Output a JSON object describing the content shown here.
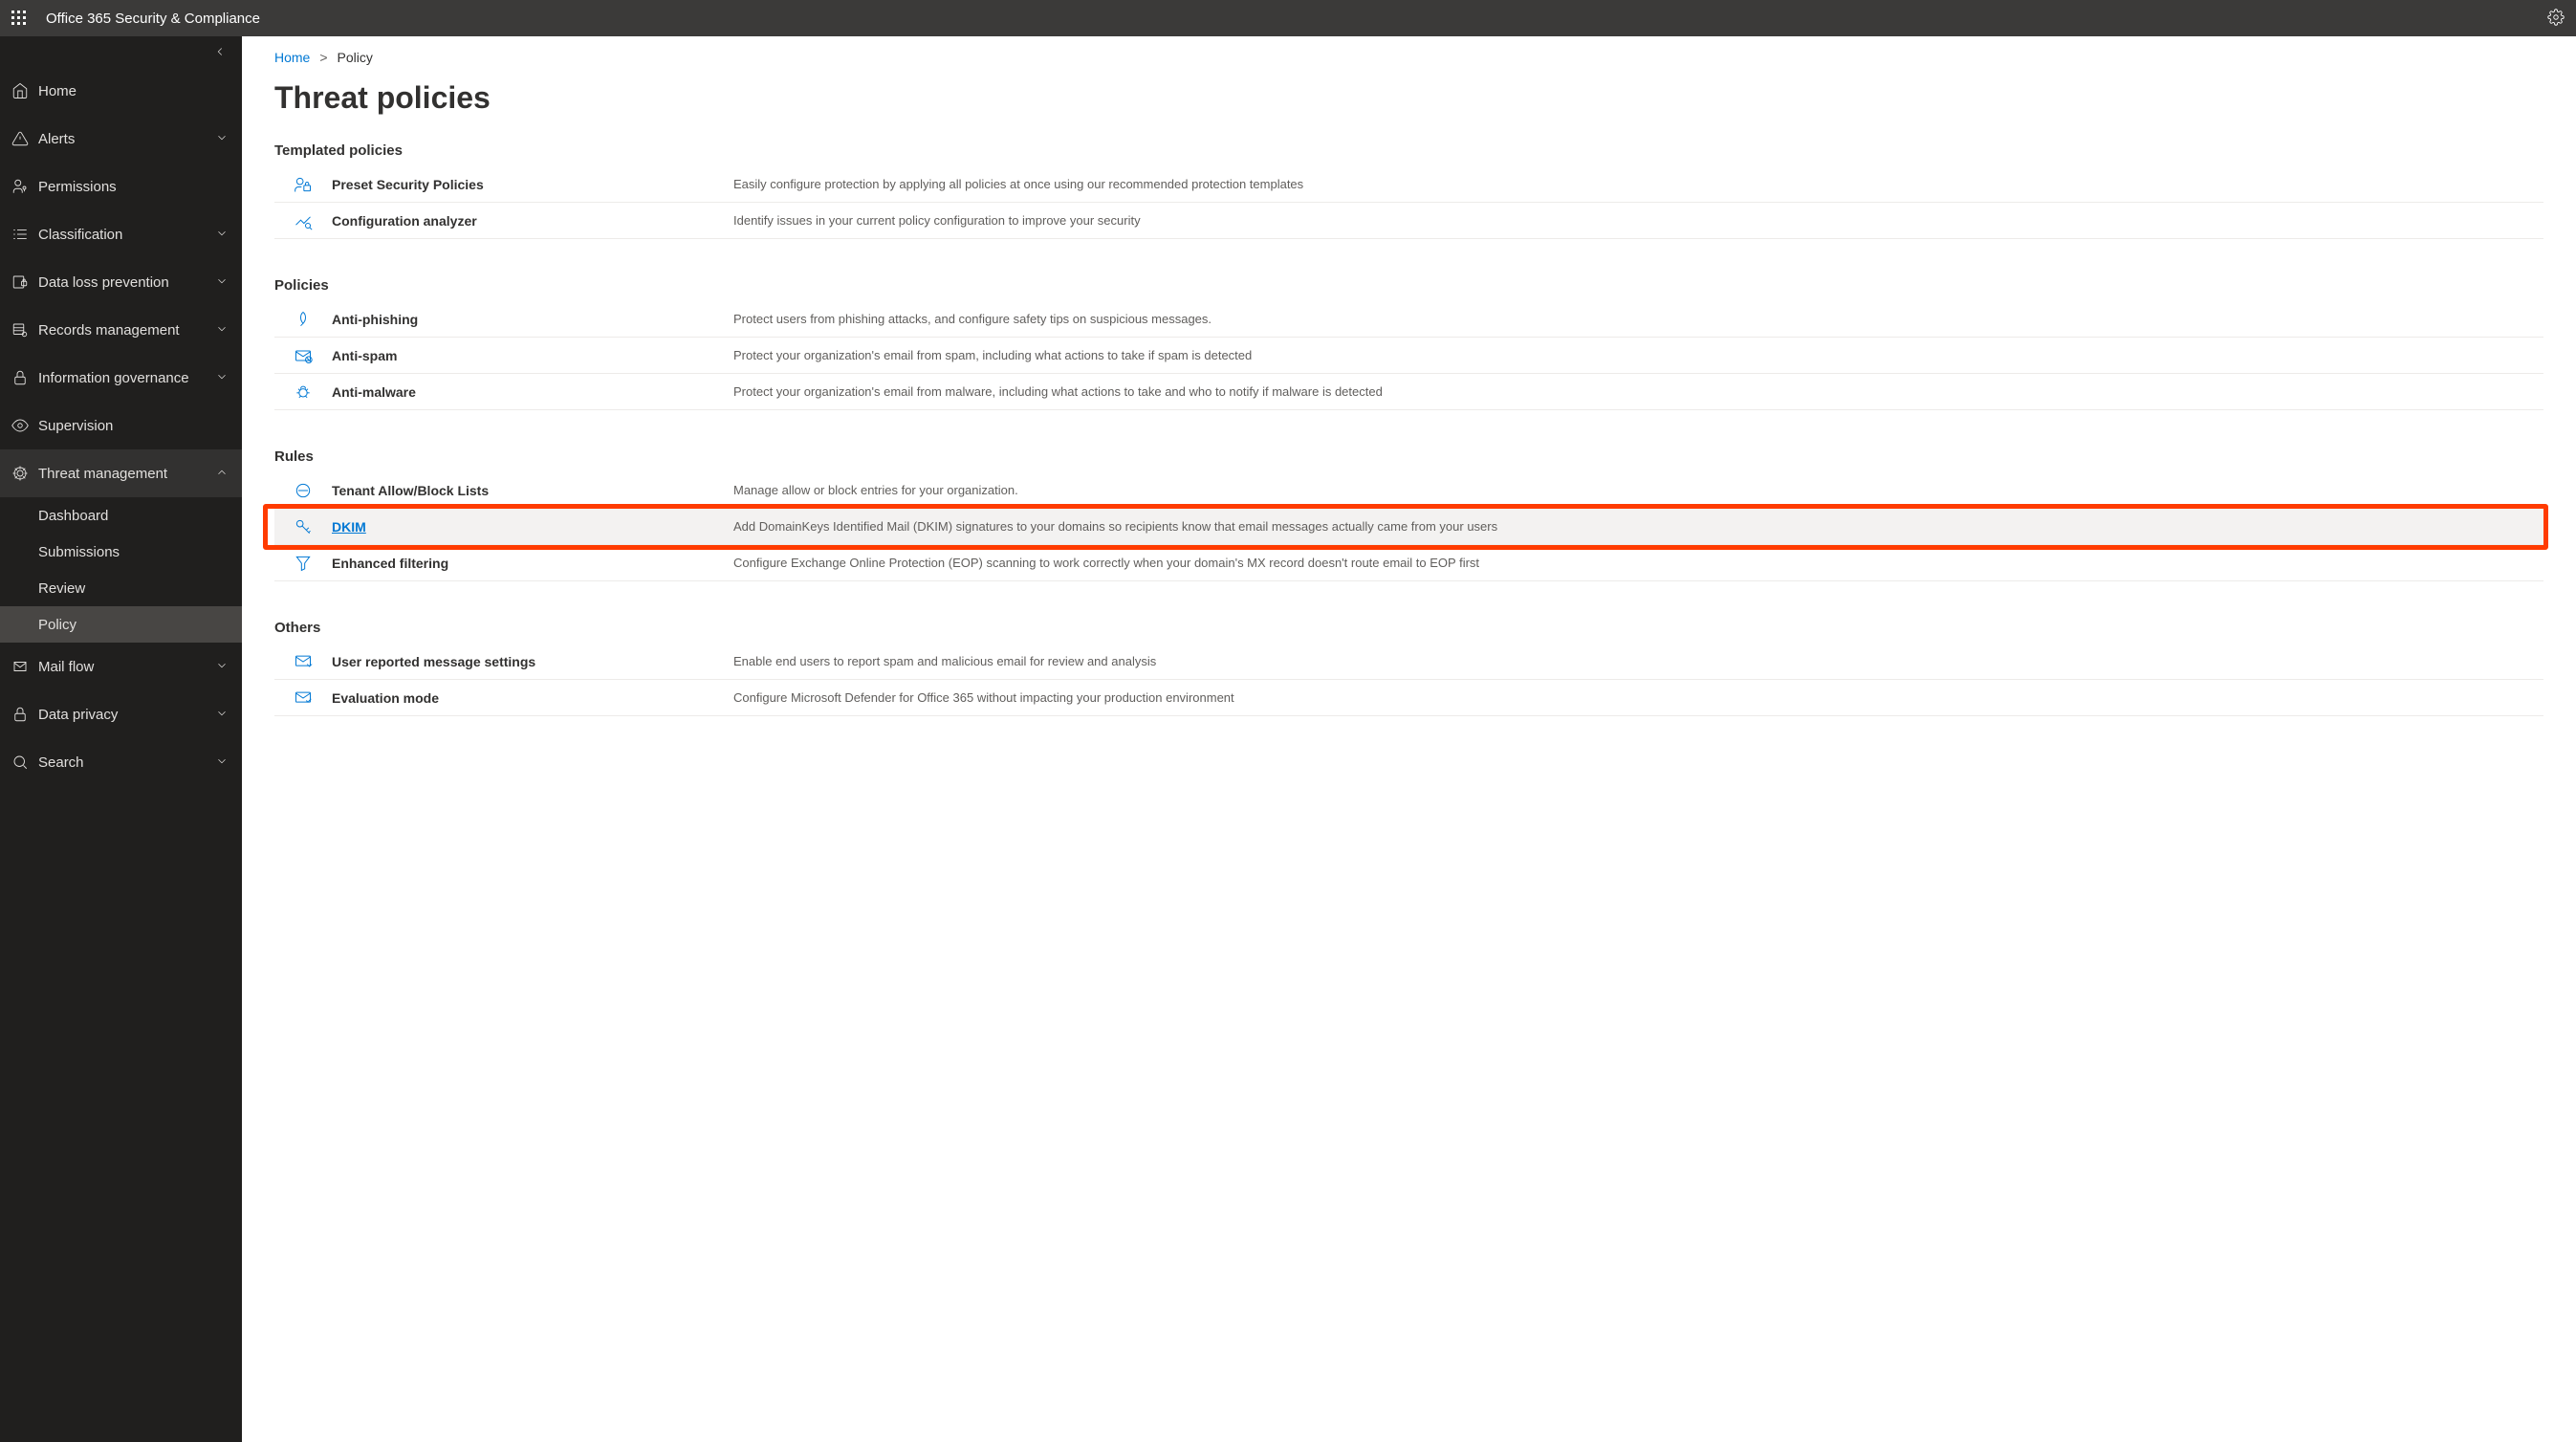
{
  "topbar": {
    "title": "Office 365 Security & Compliance"
  },
  "sidebar": {
    "items": [
      {
        "label": "Home"
      },
      {
        "label": "Alerts"
      },
      {
        "label": "Permissions"
      },
      {
        "label": "Classification"
      },
      {
        "label": "Data loss prevention"
      },
      {
        "label": "Records management"
      },
      {
        "label": "Information governance"
      },
      {
        "label": "Supervision"
      },
      {
        "label": "Threat management"
      },
      {
        "label": "Mail flow"
      },
      {
        "label": "Data privacy"
      },
      {
        "label": "Search"
      }
    ],
    "threat_sub": [
      {
        "label": "Dashboard"
      },
      {
        "label": "Submissions"
      },
      {
        "label": "Review"
      },
      {
        "label": "Policy"
      }
    ]
  },
  "breadcrumb": {
    "home": "Home",
    "current": "Policy"
  },
  "page_title": "Threat policies",
  "sections": {
    "templated": {
      "title": "Templated policies",
      "rows": [
        {
          "title": "Preset Security Policies",
          "desc": "Easily configure protection by applying all policies at once using our recommended protection templates"
        },
        {
          "title": "Configuration analyzer",
          "desc": "Identify issues in your current policy configuration to improve your security"
        }
      ]
    },
    "policies": {
      "title": "Policies",
      "rows": [
        {
          "title": "Anti-phishing",
          "desc": "Protect users from phishing attacks, and configure safety tips on suspicious messages."
        },
        {
          "title": "Anti-spam",
          "desc": "Protect your organization's email from spam, including what actions to take if spam is detected"
        },
        {
          "title": "Anti-malware",
          "desc": "Protect your organization's email from malware, including what actions to take and who to notify if malware is detected"
        }
      ]
    },
    "rules": {
      "title": "Rules",
      "rows": [
        {
          "title": "Tenant Allow/Block Lists",
          "desc": "Manage allow or block entries for your organization."
        },
        {
          "title": "DKIM",
          "desc": "Add DomainKeys Identified Mail (DKIM) signatures to your domains so recipients know that email messages actually came from your users"
        },
        {
          "title": "Enhanced filtering",
          "desc": "Configure Exchange Online Protection (EOP) scanning to work correctly when your domain's MX record doesn't route email to EOP first"
        }
      ]
    },
    "others": {
      "title": "Others",
      "rows": [
        {
          "title": "User reported message settings",
          "desc": "Enable end users to report spam and malicious email for review and analysis"
        },
        {
          "title": "Evaluation mode",
          "desc": "Configure Microsoft Defender for Office 365 without impacting your production environment"
        }
      ]
    }
  }
}
